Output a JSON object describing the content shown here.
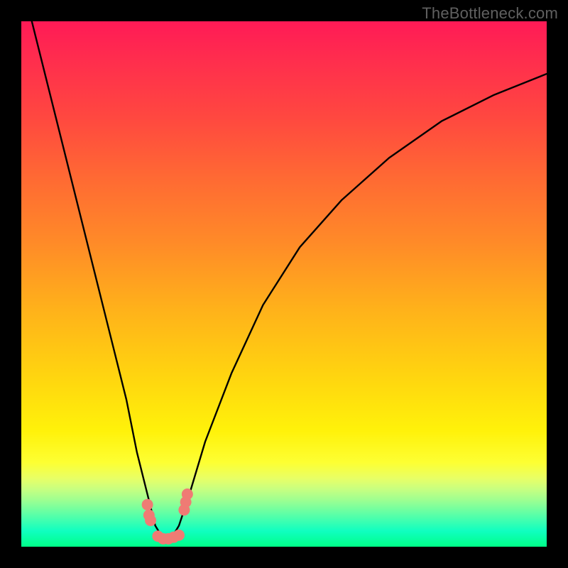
{
  "watermark": "TheBottleneck.com",
  "chart_data": {
    "type": "line",
    "title": "",
    "xlabel": "",
    "ylabel": "",
    "xlim": [
      0,
      100
    ],
    "ylim": [
      0,
      100
    ],
    "grid": false,
    "background_gradient": "vertical red→yellow→green (bottleneck severity)",
    "series": [
      {
        "name": "bottleneck-curve",
        "color": "#000000",
        "x": [
          2,
          5,
          8,
          11,
          14,
          17,
          20,
          22,
          24,
          25.5,
          27,
          28.5,
          30,
          32,
          35,
          40,
          46,
          53,
          61,
          70,
          80,
          90,
          100
        ],
        "y": [
          100,
          88,
          76,
          64,
          52,
          40,
          28,
          18,
          10,
          4,
          1.5,
          1.5,
          4,
          10,
          20,
          33,
          46,
          57,
          66,
          74,
          81,
          86,
          90
        ]
      }
    ],
    "markers": [
      {
        "name": "valley-marker",
        "color": "#ef7b74",
        "x": 24,
        "y": 8
      },
      {
        "name": "valley-marker",
        "color": "#ef7b74",
        "x": 24.3,
        "y": 6
      },
      {
        "name": "valley-marker",
        "color": "#ef7b74",
        "x": 24.6,
        "y": 5
      },
      {
        "name": "valley-marker",
        "color": "#ef7b74",
        "x": 26,
        "y": 2
      },
      {
        "name": "valley-marker",
        "color": "#ef7b74",
        "x": 27,
        "y": 1.5
      },
      {
        "name": "valley-marker",
        "color": "#ef7b74",
        "x": 28,
        "y": 1.5
      },
      {
        "name": "valley-marker",
        "color": "#ef7b74",
        "x": 29,
        "y": 1.8
      },
      {
        "name": "valley-marker",
        "color": "#ef7b74",
        "x": 30,
        "y": 2.2
      },
      {
        "name": "valley-marker",
        "color": "#ef7b74",
        "x": 31,
        "y": 7
      },
      {
        "name": "valley-marker",
        "color": "#ef7b74",
        "x": 31.3,
        "y": 8.5
      },
      {
        "name": "valley-marker",
        "color": "#ef7b74",
        "x": 31.6,
        "y": 10
      }
    ]
  }
}
